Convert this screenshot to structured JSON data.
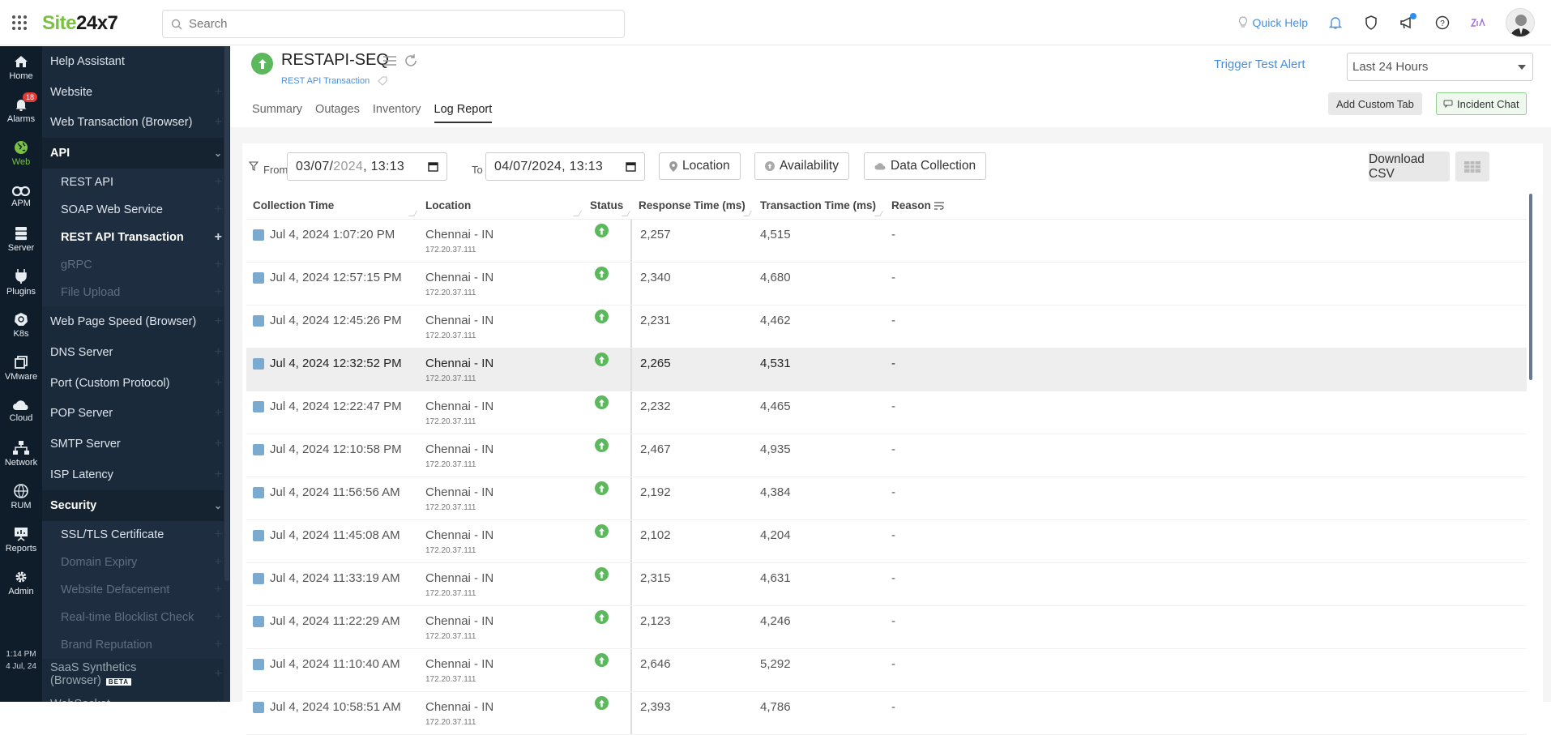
{
  "topbar": {
    "logo_green": "Site",
    "logo_dark": "24x7",
    "search_placeholder": "Search",
    "quick_help": "Quick Help"
  },
  "rail": {
    "items": [
      {
        "label": "Home",
        "icon": "home-icon"
      },
      {
        "label": "Alarms",
        "icon": "bell-icon",
        "badge": "18"
      },
      {
        "label": "Web",
        "icon": "globe-icon",
        "active": true
      },
      {
        "label": "APM",
        "icon": "binoculars-icon"
      },
      {
        "label": "Server",
        "icon": "server-icon"
      },
      {
        "label": "Plugins",
        "icon": "plug-icon"
      },
      {
        "label": "K8s",
        "icon": "kubernetes-icon"
      },
      {
        "label": "VMware",
        "icon": "vmware-icon"
      },
      {
        "label": "Cloud",
        "icon": "cloud-icon"
      },
      {
        "label": "Network",
        "icon": "network-icon"
      },
      {
        "label": "RUM",
        "icon": "rum-icon"
      },
      {
        "label": "Reports",
        "icon": "reports-icon"
      },
      {
        "label": "Admin",
        "icon": "gear-icon"
      }
    ],
    "time": "1:14 PM",
    "date": "4 Jul, 24"
  },
  "nav": {
    "items": [
      {
        "label": "Help Assistant",
        "type": "group"
      },
      {
        "label": "Website",
        "type": "group",
        "plus": true
      },
      {
        "label": "Web Transaction (Browser)",
        "type": "group",
        "plus": true
      },
      {
        "label": "API",
        "type": "open"
      },
      {
        "label": "REST API",
        "type": "sub",
        "plus": true
      },
      {
        "label": "SOAP Web Service",
        "type": "sub",
        "plus": true
      },
      {
        "label": "REST API Transaction",
        "type": "sub-bold",
        "plus": true
      },
      {
        "label": "gRPC",
        "type": "sub-dim",
        "plus": true
      },
      {
        "label": "File Upload",
        "type": "sub-dim",
        "plus": true
      },
      {
        "label": "Web Page Speed (Browser)",
        "type": "group",
        "plus": true
      },
      {
        "label": "DNS Server",
        "type": "group",
        "plus": true
      },
      {
        "label": "Port (Custom Protocol)",
        "type": "group",
        "plus": true
      },
      {
        "label": "POP Server",
        "type": "group",
        "plus": true
      },
      {
        "label": "SMTP Server",
        "type": "group",
        "plus": true
      },
      {
        "label": "ISP Latency",
        "type": "group",
        "plus": true
      },
      {
        "label": "Security",
        "type": "open"
      },
      {
        "label": "SSL/TLS Certificate",
        "type": "sub",
        "plus": true
      },
      {
        "label": "Domain Expiry",
        "type": "sub-dim",
        "plus": true
      },
      {
        "label": "Website Defacement",
        "type": "sub-dim",
        "plus": true
      },
      {
        "label": "Real-time Blocklist Check",
        "type": "sub-dim",
        "plus": true
      },
      {
        "label": "Brand Reputation",
        "type": "sub-dim",
        "plus": true
      },
      {
        "label": "SaaS Synthetics (Browser)",
        "type": "group-dim",
        "plus": true,
        "badge": "BETA"
      },
      {
        "label": "WebSocket",
        "type": "group-dim",
        "plus": true
      }
    ]
  },
  "monitor": {
    "name": "RESTAPI-SEQ",
    "type": "REST API Transaction",
    "status": "up"
  },
  "tabs": [
    "Summary",
    "Outages",
    "Inventory",
    "Log Report"
  ],
  "active_tab": "Log Report",
  "actions": {
    "trigger_test_alert": "Trigger Test Alert",
    "period": "Last 24 Hours",
    "add_custom_tab": "Add Custom Tab",
    "incident_chat": "Incident Chat"
  },
  "filters": {
    "from_label": "From",
    "from_date": "03/07/",
    "from_year": "2024",
    "from_time": ", 13:13",
    "to_label": "To",
    "to_value": "04/07/2024, 13:13",
    "location": "Location",
    "availability": "Availability",
    "data_collection": "Data Collection",
    "download_csv": "Download CSV"
  },
  "table": {
    "columns": [
      "Collection Time",
      "Location",
      "Status",
      "Response Time (ms)",
      "Transaction Time (ms)",
      "Reason"
    ],
    "rows": [
      {
        "time": "Jul 4, 2024 1:07:20 PM",
        "location": "Chennai - IN",
        "ip": "172.20.37.111",
        "status": "up",
        "response": "2,257",
        "transaction": "4,515",
        "reason": "-"
      },
      {
        "time": "Jul 4, 2024 12:57:15 PM",
        "location": "Chennai - IN",
        "ip": "172.20.37.111",
        "status": "up",
        "response": "2,340",
        "transaction": "4,680",
        "reason": "-"
      },
      {
        "time": "Jul 4, 2024 12:45:26 PM",
        "location": "Chennai - IN",
        "ip": "172.20.37.111",
        "status": "up",
        "response": "2,231",
        "transaction": "4,462",
        "reason": "-"
      },
      {
        "time": "Jul 4, 2024 12:32:52 PM",
        "location": "Chennai - IN",
        "ip": "172.20.37.111",
        "status": "up",
        "response": "2,265",
        "transaction": "4,531",
        "reason": "-",
        "highlighted": true
      },
      {
        "time": "Jul 4, 2024 12:22:47 PM",
        "location": "Chennai - IN",
        "ip": "172.20.37.111",
        "status": "up",
        "response": "2,232",
        "transaction": "4,465",
        "reason": "-"
      },
      {
        "time": "Jul 4, 2024 12:10:58 PM",
        "location": "Chennai - IN",
        "ip": "172.20.37.111",
        "status": "up",
        "response": "2,467",
        "transaction": "4,935",
        "reason": "-"
      },
      {
        "time": "Jul 4, 2024 11:56:56 AM",
        "location": "Chennai - IN",
        "ip": "172.20.37.111",
        "status": "up",
        "response": "2,192",
        "transaction": "4,384",
        "reason": "-"
      },
      {
        "time": "Jul 4, 2024 11:45:08 AM",
        "location": "Chennai - IN",
        "ip": "172.20.37.111",
        "status": "up",
        "response": "2,102",
        "transaction": "4,204",
        "reason": "-"
      },
      {
        "time": "Jul 4, 2024 11:33:19 AM",
        "location": "Chennai - IN",
        "ip": "172.20.37.111",
        "status": "up",
        "response": "2,315",
        "transaction": "4,631",
        "reason": "-"
      },
      {
        "time": "Jul 4, 2024 11:22:29 AM",
        "location": "Chennai - IN",
        "ip": "172.20.37.111",
        "status": "up",
        "response": "2,123",
        "transaction": "4,246",
        "reason": "-"
      },
      {
        "time": "Jul 4, 2024 11:10:40 AM",
        "location": "Chennai - IN",
        "ip": "172.20.37.111",
        "status": "up",
        "response": "2,646",
        "transaction": "5,292",
        "reason": "-"
      },
      {
        "time": "Jul 4, 2024 10:58:51 AM",
        "location": "Chennai - IN",
        "ip": "172.20.37.111",
        "status": "up",
        "response": "2,393",
        "transaction": "4,786",
        "reason": "-"
      }
    ]
  },
  "colors": {
    "brand_green": "#7ac143",
    "status_up": "#5cb85c",
    "link_blue": "#4a90d9",
    "nav_bg": "#1b2a3b",
    "rail_bg": "#0f1d2b"
  }
}
